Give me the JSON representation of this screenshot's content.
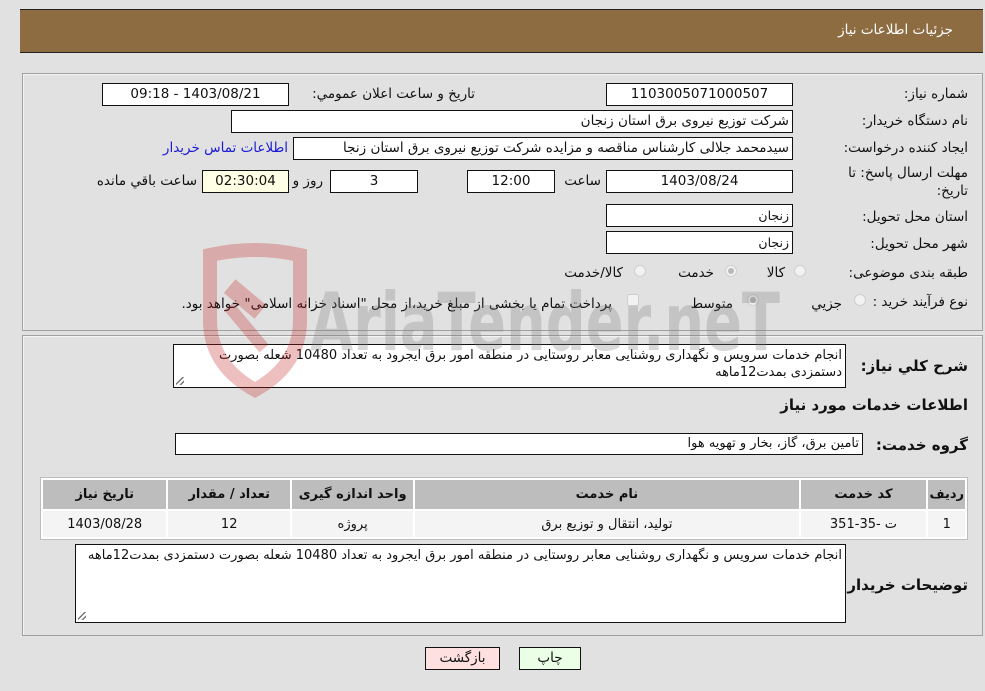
{
  "header": {
    "title": "جزئیات اطلاعات نیاز"
  },
  "fields": {
    "need_number": {
      "label": "شماره نیاز:",
      "value": "1103005071000507"
    },
    "announce_datetime": {
      "label": "تاریخ و ساعت اعلان عمومي:",
      "value": "1403/08/21 - 09:18"
    },
    "buyer_org": {
      "label": "نام دستگاه خريدار:",
      "value": "شرکت توزیع نیروی برق استان زنجان"
    },
    "requester": {
      "label": "ایجاد کننده درخواست:",
      "value": "سیدمحمد جلالی کارشناس مناقصه و مزایده شرکت توزیع نیروی برق استان زنجا",
      "contact_link": "اطلاعات تماس خریدار"
    },
    "deadline": {
      "label_line1": "مهلت ارسال پاسخ: تا",
      "label_line2": "تاریخ:",
      "date": "1403/08/24",
      "time_label": "ساعت",
      "time": "12:00",
      "days": "3",
      "days_label": "روز و",
      "remaining": "02:30:04",
      "remaining_label": "ساعت باقي مانده"
    },
    "province": {
      "label": "استان محل تحویل:",
      "value": "زنجان"
    },
    "city": {
      "label": "شهر محل تحویل:",
      "value": "زنجان"
    },
    "category": {
      "label": "طبقه بندی موضوعی:",
      "options": [
        {
          "label": "کالا",
          "checked": false
        },
        {
          "label": "خدمت",
          "checked": true
        },
        {
          "label": "کالا/خدمت",
          "checked": false
        }
      ]
    },
    "purchase_type": {
      "label": "نوع فرآيند خريد :",
      "options": [
        {
          "label": "جزيي",
          "checked": false
        },
        {
          "label": "متوسط",
          "checked": true
        }
      ],
      "treasury_note": "پرداخت تمام یا بخشی از مبلغ خرید،از محل \"اسناد خزانه اسلامی\" خواهد بود."
    }
  },
  "description": {
    "label": "شرح کلي نياز:",
    "value": "انجام خدمات سرویس و نگهداری روشنایی معابر روستایی در منطقه امور برق ایجرود به تعداد 10480 شعله بصورت دستمزدی بمدت12ماهه"
  },
  "services": {
    "section_title": "اطلاعات خدمات مورد نياز",
    "group_label": "گروه خدمت:",
    "group_value": "تامین برق، گاز، بخار و تهویه هوا",
    "table": {
      "headers": [
        "رديف",
        "کد خدمت",
        "نام خدمت",
        "واحد اندازه گيری",
        "تعداد / مقدار",
        "تاريخ نياز"
      ],
      "rows": [
        [
          "1",
          "ت -35-351",
          "تولید، انتقال و توزیع برق",
          "پروژه",
          "12",
          "1403/08/28"
        ]
      ]
    }
  },
  "buyer_notes": {
    "label": "توضيحات خريدار:",
    "value": "انجام خدمات سرویس و نگهداری روشنایی معابر روستایی در منطقه امور برق ایجرود به تعداد 10480 شعله بصورت دستمزدی بمدت12ماهه"
  },
  "buttons": {
    "print": "چاپ",
    "back": "بازگشت"
  },
  "watermark": {
    "text": "AriaTender.neT"
  },
  "colors": {
    "header_bg": "#8d6c42",
    "link": "#1a1ad6",
    "print_bg": "#ebffe6",
    "back_bg": "#ffe0e0"
  }
}
